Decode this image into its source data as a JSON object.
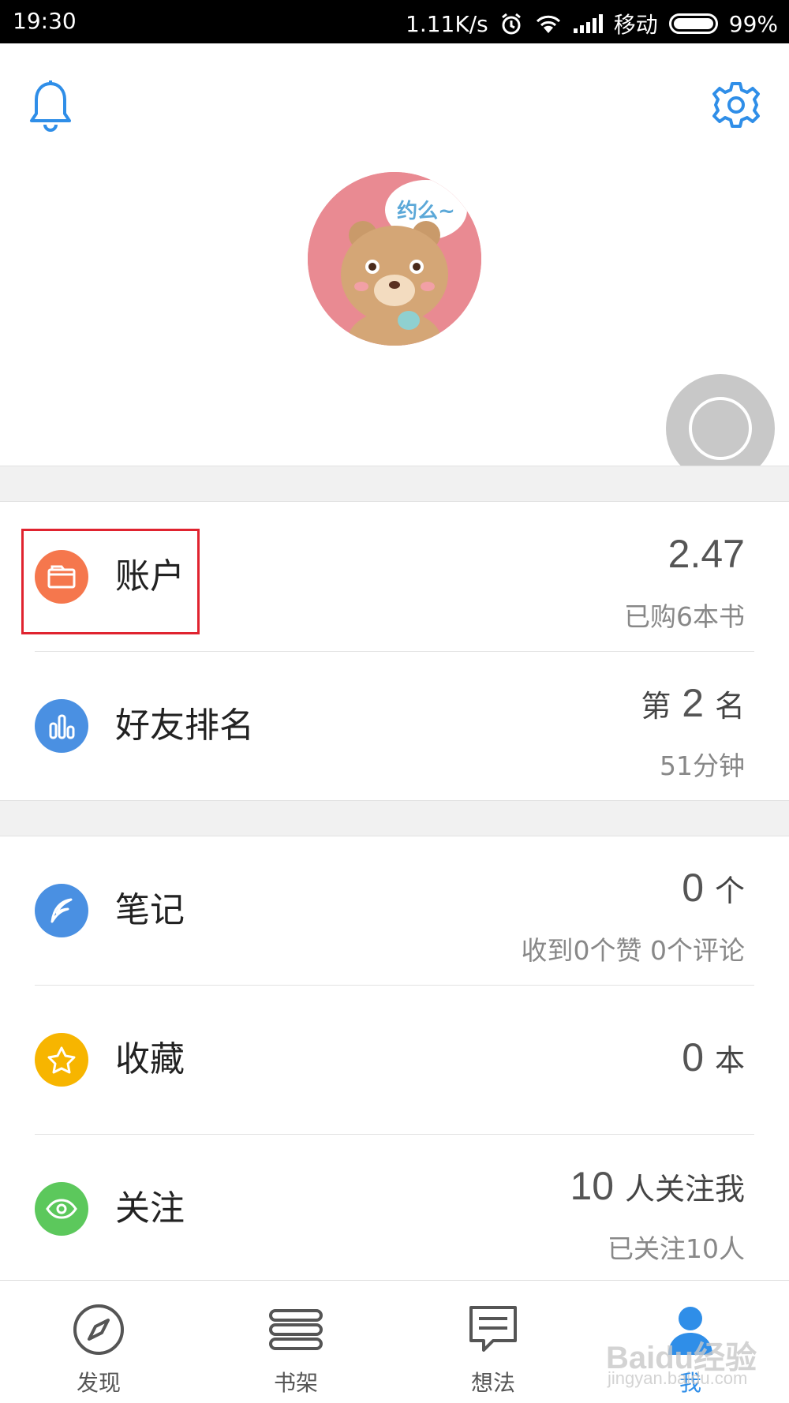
{
  "status_bar": {
    "time": "19:30",
    "speed": "1.11K/s",
    "carrier": "移动",
    "battery": "99%"
  },
  "colors": {
    "accent": "#2f8ee8",
    "account": "#f5774d",
    "ranking": "#4a90e2",
    "notes": "#4a90e2",
    "favorites": "#f7b500",
    "follow": "#5cc85c",
    "highlight": "#e0232f"
  },
  "account": {
    "label": "账户",
    "value": "2.47",
    "sub": "已购6本书"
  },
  "ranking": {
    "label": "好友排名",
    "prefix": "第",
    "rank": "2",
    "suffix": "名",
    "sub": "51分钟"
  },
  "notes": {
    "label": "笔记",
    "count": "0",
    "unit": "个",
    "sub": "收到0个赞 0个评论"
  },
  "favorites": {
    "label": "收藏",
    "count": "0",
    "unit": "本"
  },
  "follow": {
    "label": "关注",
    "count": "10",
    "unit": "人关注我",
    "sub": "已关注10人"
  },
  "avatar": {
    "bubble_text": "约么~"
  },
  "tabs": [
    {
      "label": "发现",
      "icon": "compass-icon"
    },
    {
      "label": "书架",
      "icon": "bookshelf-icon"
    },
    {
      "label": "想法",
      "icon": "chat-icon"
    },
    {
      "label": "我",
      "icon": "person-icon"
    }
  ],
  "watermark": {
    "brand": "Baidu经验",
    "url": "jingyan.baidu.com"
  }
}
